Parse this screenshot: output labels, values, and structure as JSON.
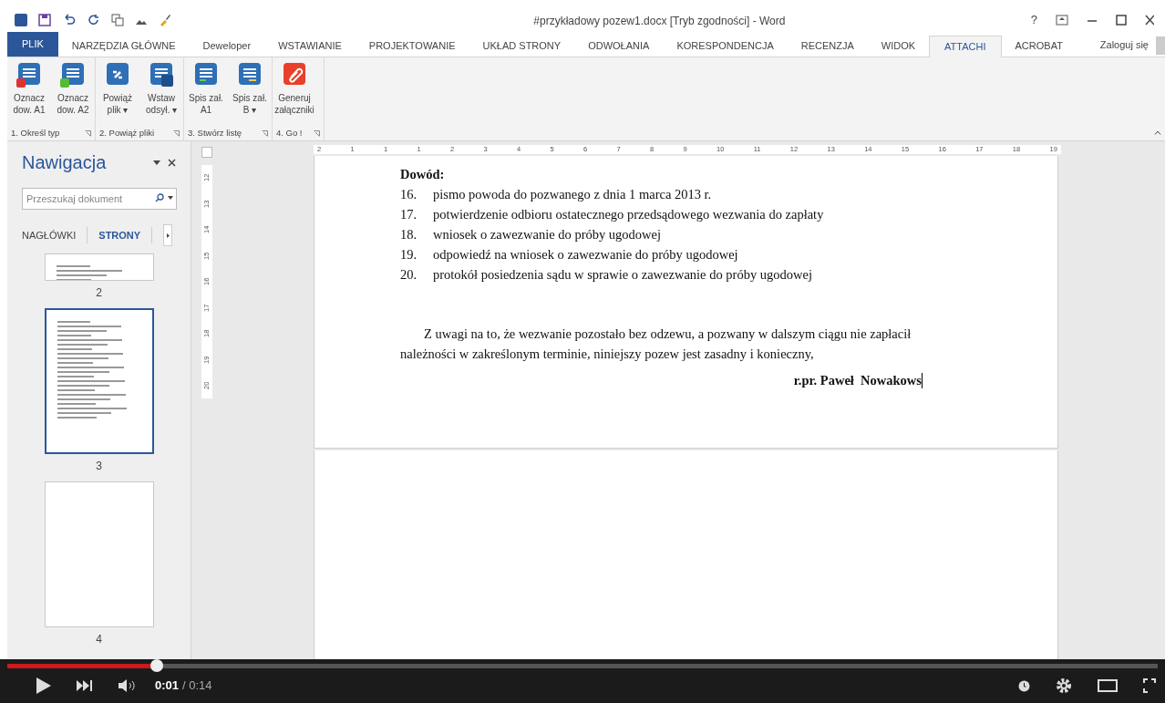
{
  "window": {
    "title": "#przykładowy pozew1.docx [Tryb zgodności] - Word",
    "controls": [
      "?"
    ]
  },
  "file_tab": "PLIK",
  "tabs": [
    {
      "label": "NARZĘDZIA GŁÓWNE",
      "selected": false
    },
    {
      "label": "Deweloper",
      "selected": false
    },
    {
      "label": "WSTAWIANIE",
      "selected": false
    },
    {
      "label": "PROJEKTOWANIE",
      "selected": false
    },
    {
      "label": "UKŁAD STRONY",
      "selected": false
    },
    {
      "label": "ODWOŁANIA",
      "selected": false
    },
    {
      "label": "KORESPONDENCJA",
      "selected": false
    },
    {
      "label": "RECENZJA",
      "selected": false
    },
    {
      "label": "WIDOK",
      "selected": false
    },
    {
      "label": "ATTACHI",
      "selected": true
    },
    {
      "label": "ACROBAT",
      "selected": false
    }
  ],
  "sign_in": "Zaloguj się",
  "ribbon_groups": [
    {
      "label": "1. Określ typ",
      "buttons": [
        {
          "label": "Oznacz dow. A1",
          "kind": "mark-red"
        },
        {
          "label": "Oznacz dow. A2",
          "kind": "mark-green"
        }
      ]
    },
    {
      "label": "2. Powiąż pliki",
      "buttons": [
        {
          "label": "Powiąż plik ▾",
          "kind": "link"
        },
        {
          "label": "Wstaw odsył. ▾",
          "kind": "insert"
        }
      ]
    },
    {
      "label": "3. Stwórz listę",
      "buttons": [
        {
          "label": "Spis zał. A1",
          "kind": "list-green"
        },
        {
          "label": "Spis zał. B ▾",
          "kind": "list-yellow"
        }
      ]
    },
    {
      "label": "4. Go !",
      "buttons": [
        {
          "label": "Generuj załączniki",
          "kind": "clip"
        }
      ]
    }
  ],
  "navigation": {
    "title": "Nawigacja",
    "search": {
      "placeholder": "Przeszukaj dokument"
    },
    "tabs": [
      {
        "label": "NAGŁÓWKI",
        "selected": false
      },
      {
        "label": "STRONY",
        "selected": true
      }
    ],
    "pages": [
      {
        "number": "2",
        "kind": "cut",
        "selected": false
      },
      {
        "number": "3",
        "kind": "full",
        "selected": true
      },
      {
        "number": "4",
        "kind": "blank",
        "selected": false
      }
    ]
  },
  "ruler": {
    "horizontal": [
      "2",
      "1",
      "1",
      "1",
      "2",
      "3",
      "4",
      "5",
      "6",
      "7",
      "8",
      "9",
      "10",
      "11",
      "12",
      "13",
      "14",
      "15",
      "16",
      "17",
      "18",
      "19"
    ],
    "vertical": [
      "12",
      "13",
      "14",
      "15",
      "16",
      "17",
      "18",
      "19",
      "20"
    ]
  },
  "document": {
    "heading": "Dowód:",
    "items": [
      {
        "number": "16.",
        "text": "pismo powoda do pozwanego z dnia 1 marca 2013 r."
      },
      {
        "number": "17.",
        "text": "potwierdzenie odbioru ostatecznego przedsądowego wezwania do zapłaty"
      },
      {
        "number": "18.",
        "text": "wniosek o zawezwanie do próby ugodowej"
      },
      {
        "number": "19.",
        "text": "odpowiedź na wniosek o zawezwanie do próby ugodowej"
      },
      {
        "number": "20.",
        "text": "protokół posiedzenia sądu w sprawie o zawezwanie do próby ugodowej"
      }
    ],
    "paragraph": "Z uwagi na to, że wezwanie pozostało bez odzewu, a pozwany w dalszym ciągu nie zapłacił należności w zakreślonym terminie, niniejszy pozew jest zasadny i konieczny,",
    "signature": "r.pr. Paweł  Nowakows"
  },
  "player": {
    "progress": {
      "level": 0.13
    },
    "time_current": "0:01",
    "time_total": "/ 0:14"
  }
}
